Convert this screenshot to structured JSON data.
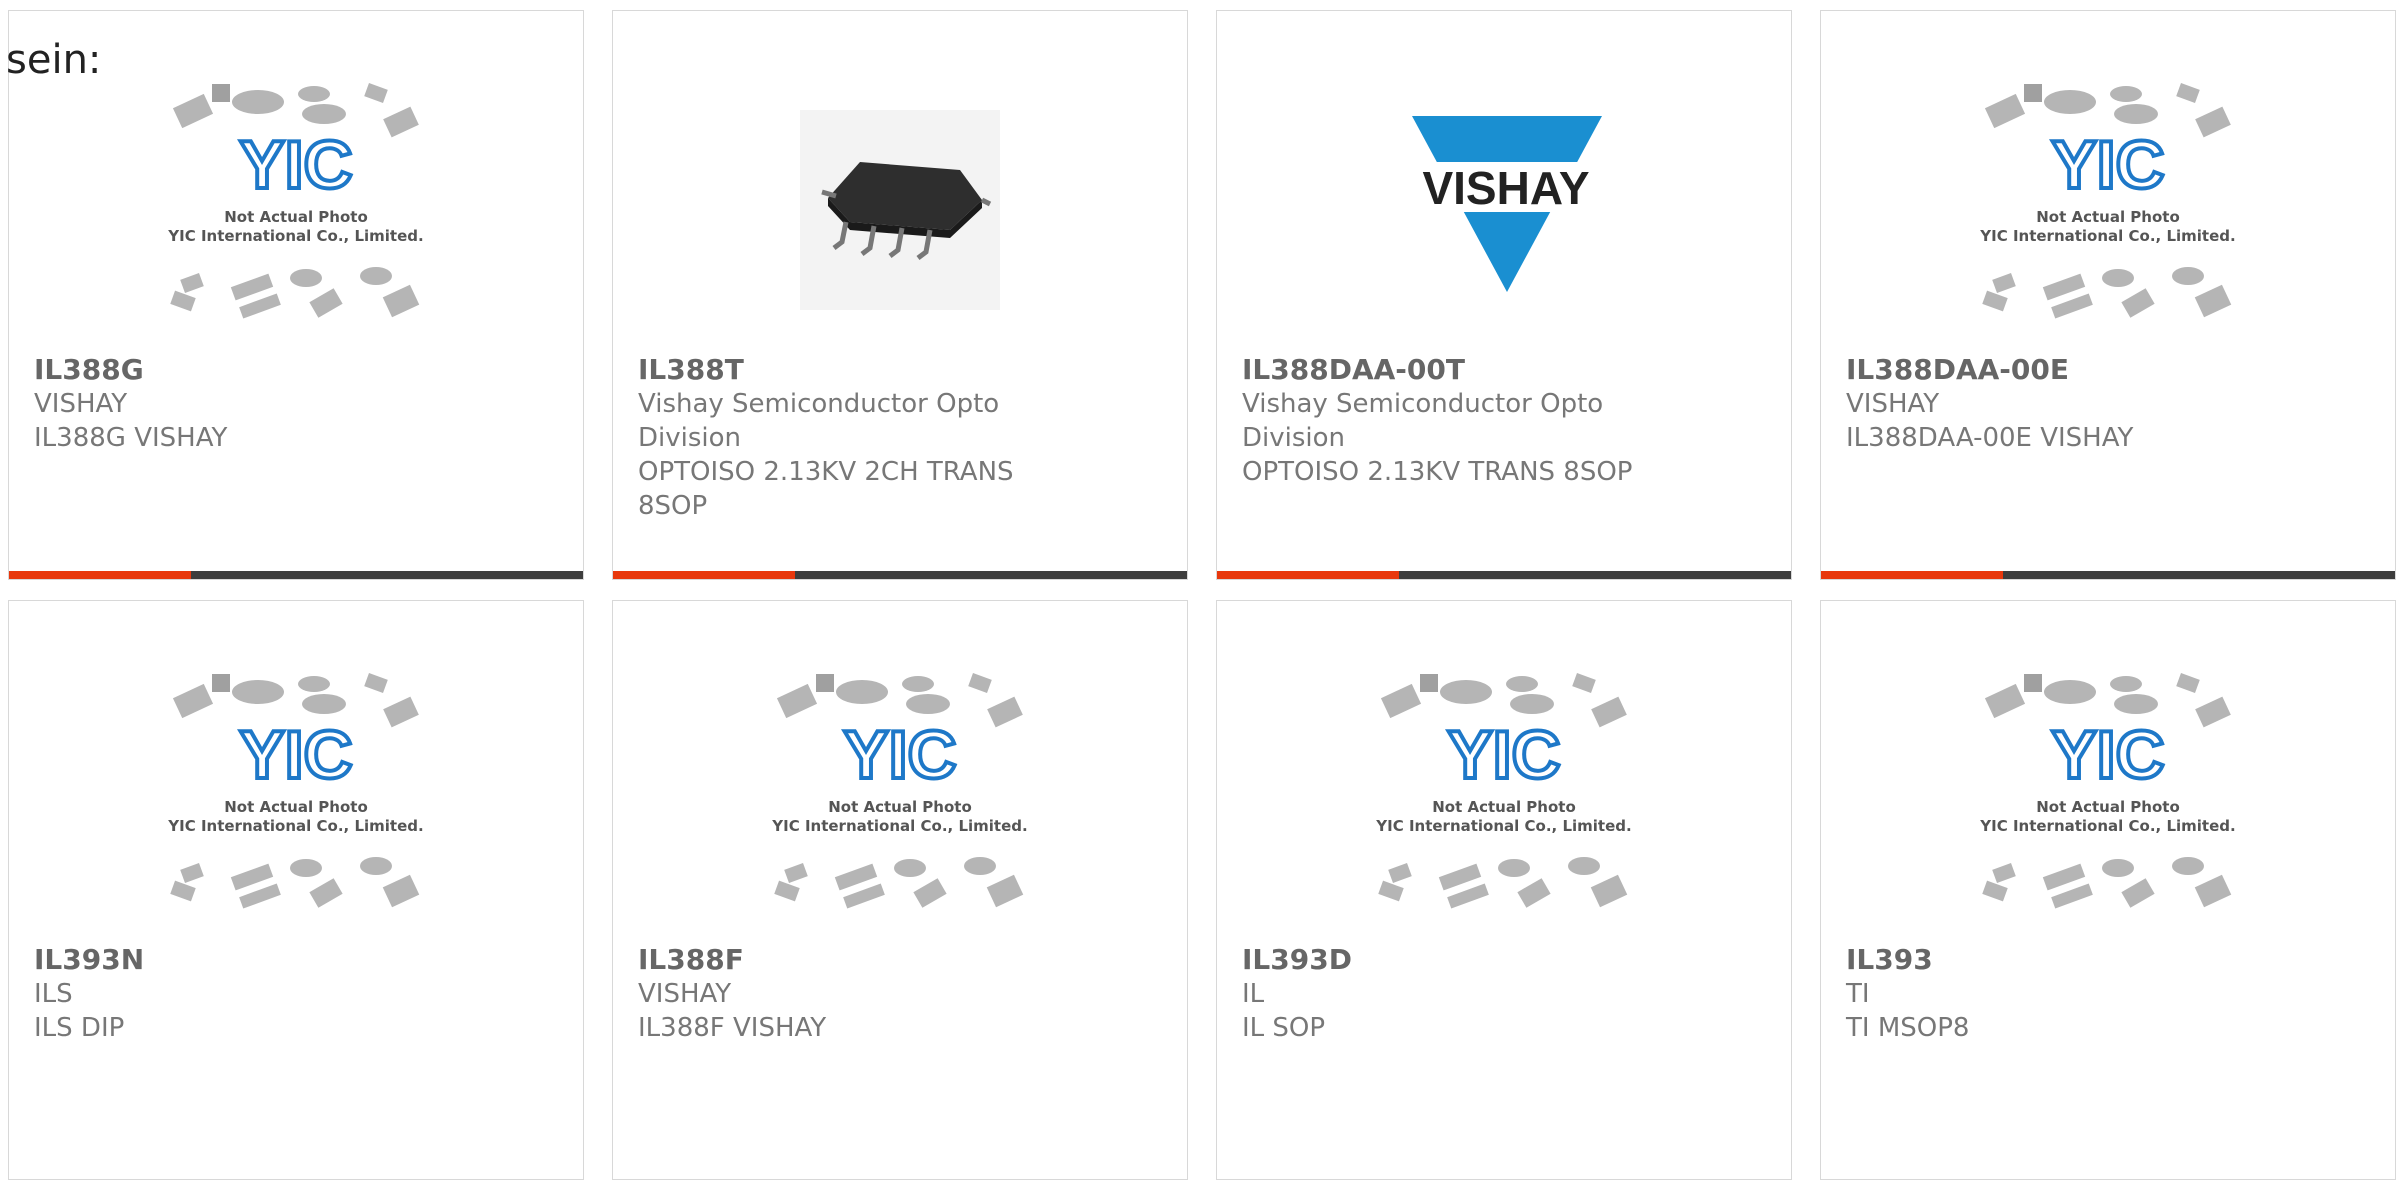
{
  "intro_text": "sein:",
  "colors": {
    "accent": "#e8380d",
    "bar": "#3d3d3d",
    "vishay_blue": "#1a8fd1",
    "yic_blue": "#1e78c8"
  },
  "placeholder_caption": {
    "line1": "Not Actual Photo",
    "line2": "YIC International Co., Limited.",
    "logo": "YIC"
  },
  "vishay_logo_text": "VISHAY",
  "products": [
    {
      "part": "IL388G",
      "maker": "VISHAY",
      "lines": [
        "IL388G VISHAY"
      ],
      "image": "placeholder"
    },
    {
      "part": "IL388T",
      "maker": "Vishay Semiconductor Opto",
      "lines": [
        "Division",
        "OPTOISO 2.13KV 2CH TRANS",
        "8SOP"
      ],
      "image": "chip-photo"
    },
    {
      "part": "IL388DAA-00T",
      "maker": "Vishay Semiconductor Opto",
      "lines": [
        "Division",
        "OPTOISO 2.13KV TRANS 8SOP"
      ],
      "image": "vishay-logo"
    },
    {
      "part": "IL388DAA-00E",
      "maker": "VISHAY",
      "lines": [
        "IL388DAA-00E VISHAY"
      ],
      "image": "placeholder"
    },
    {
      "part": "IL393N",
      "maker": "ILS",
      "lines": [
        "ILS DIP"
      ],
      "image": "placeholder"
    },
    {
      "part": "IL388F",
      "maker": "VISHAY",
      "lines": [
        "IL388F VISHAY"
      ],
      "image": "placeholder"
    },
    {
      "part": "IL393D",
      "maker": "IL",
      "lines": [
        "IL SOP"
      ],
      "image": "placeholder"
    },
    {
      "part": "IL393",
      "maker": "TI",
      "lines": [
        "TI MSOP8"
      ],
      "image": "placeholder"
    }
  ]
}
